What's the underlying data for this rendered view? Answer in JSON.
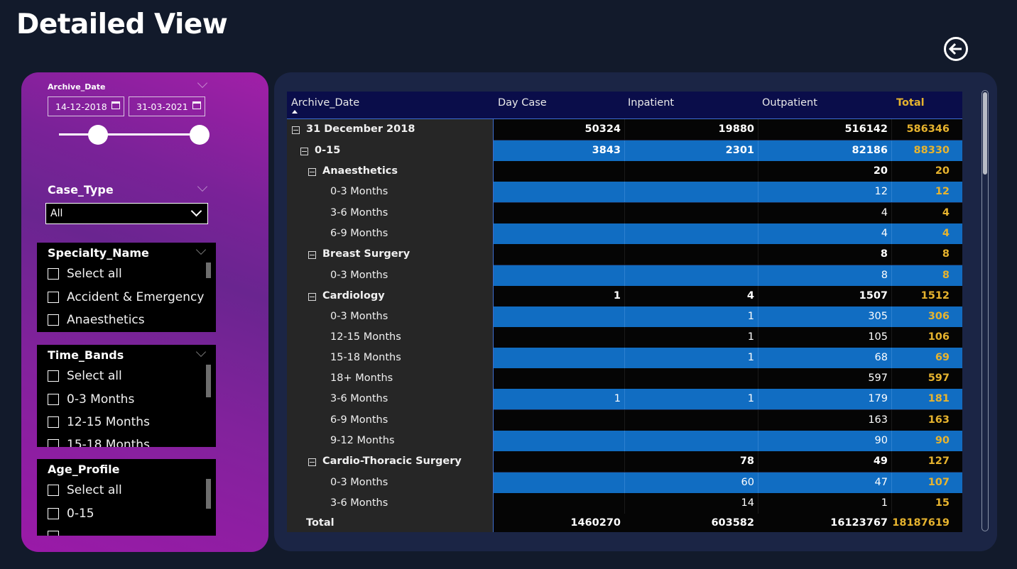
{
  "page": {
    "title": "Detailed View"
  },
  "icons": {
    "back": "back-arrow-circle-icon",
    "calendar": "calendar-icon",
    "expand": "collapse-minus-icon",
    "chevron": "chevron-down-icon"
  },
  "colors": {
    "panel_gradient_start": "#a11fa8",
    "panel_gradient_end": "#6a2590",
    "total_gold": "#e6b32e",
    "row_blue": "#116dc2",
    "header_navy": "#0a0d4a",
    "background": "#121a2b"
  },
  "filters": {
    "archive_date": {
      "label": "Archive_Date",
      "start": "14-12-2018",
      "end": "31-03-2021",
      "range_start_fraction": 0.28,
      "range_end_fraction": 1.0
    },
    "case_type": {
      "label": "Case_Type",
      "selected": "All"
    },
    "specialty": {
      "title": "Specialty_Name",
      "options": [
        "Select all",
        "Accident & Emergency",
        "Anaesthetics"
      ]
    },
    "time_bands": {
      "title": "Time_Bands",
      "options": [
        "Select all",
        "0-3 Months",
        "12-15 Months",
        "15-18 Months"
      ]
    },
    "age_profile": {
      "title": "Age_Profile",
      "options": [
        "Select all",
        "0-15",
        ""
      ]
    }
  },
  "matrix": {
    "headers": {
      "row": "Archive_Date",
      "c1": "Day Case",
      "c2": "Inpatient",
      "c3": "Outpatient",
      "c4": "Total"
    },
    "rows": [
      {
        "label": "31 December 2018",
        "bold": true,
        "level": 0,
        "expand": true,
        "vals": [
          "50324",
          "19880",
          "516142",
          "586346"
        ]
      },
      {
        "label": "0-15",
        "bold": true,
        "level": 1,
        "expand": true,
        "vals": [
          "3843",
          "2301",
          "82186",
          "88330"
        ]
      },
      {
        "label": "Anaesthetics",
        "bold": true,
        "level": 2,
        "expand": true,
        "vals": [
          "",
          "",
          "20",
          "20"
        ]
      },
      {
        "label": "0-3 Months",
        "bold": false,
        "level": 3,
        "expand": false,
        "vals": [
          "",
          "",
          "12",
          "12"
        ]
      },
      {
        "label": "3-6 Months",
        "bold": false,
        "level": 3,
        "expand": false,
        "vals": [
          "",
          "",
          "4",
          "4"
        ]
      },
      {
        "label": "6-9 Months",
        "bold": false,
        "level": 3,
        "expand": false,
        "vals": [
          "",
          "",
          "4",
          "4"
        ]
      },
      {
        "label": "Breast Surgery",
        "bold": true,
        "level": 2,
        "expand": true,
        "vals": [
          "",
          "",
          "8",
          "8"
        ]
      },
      {
        "label": "0-3 Months",
        "bold": false,
        "level": 3,
        "expand": false,
        "vals": [
          "",
          "",
          "8",
          "8"
        ]
      },
      {
        "label": "Cardiology",
        "bold": true,
        "level": 2,
        "expand": true,
        "vals": [
          "1",
          "4",
          "1507",
          "1512"
        ]
      },
      {
        "label": "0-3 Months",
        "bold": false,
        "level": 3,
        "expand": false,
        "vals": [
          "",
          "1",
          "305",
          "306"
        ]
      },
      {
        "label": "12-15 Months",
        "bold": false,
        "level": 3,
        "expand": false,
        "vals": [
          "",
          "1",
          "105",
          "106"
        ]
      },
      {
        "label": "15-18 Months",
        "bold": false,
        "level": 3,
        "expand": false,
        "vals": [
          "",
          "1",
          "68",
          "69"
        ]
      },
      {
        "label": "18+ Months",
        "bold": false,
        "level": 3,
        "expand": false,
        "vals": [
          "",
          "",
          "597",
          "597"
        ]
      },
      {
        "label": "3-6 Months",
        "bold": false,
        "level": 3,
        "expand": false,
        "vals": [
          "1",
          "1",
          "179",
          "181"
        ]
      },
      {
        "label": "6-9 Months",
        "bold": false,
        "level": 3,
        "expand": false,
        "vals": [
          "",
          "",
          "163",
          "163"
        ]
      },
      {
        "label": "9-12 Months",
        "bold": false,
        "level": 3,
        "expand": false,
        "vals": [
          "",
          "",
          "90",
          "90"
        ]
      },
      {
        "label": "Cardio-Thoracic Surgery",
        "bold": true,
        "level": 2,
        "expand": true,
        "vals": [
          "",
          "78",
          "49",
          "127"
        ]
      },
      {
        "label": "0-3 Months",
        "bold": false,
        "level": 3,
        "expand": false,
        "vals": [
          "",
          "60",
          "47",
          "107"
        ]
      },
      {
        "label": "3-6 Months",
        "bold": false,
        "level": 3,
        "expand": false,
        "vals": [
          "",
          "14",
          "1",
          "15"
        ]
      }
    ],
    "total": {
      "label": "Total",
      "vals": [
        "1460270",
        "603582",
        "16123767",
        "18187619"
      ]
    }
  }
}
